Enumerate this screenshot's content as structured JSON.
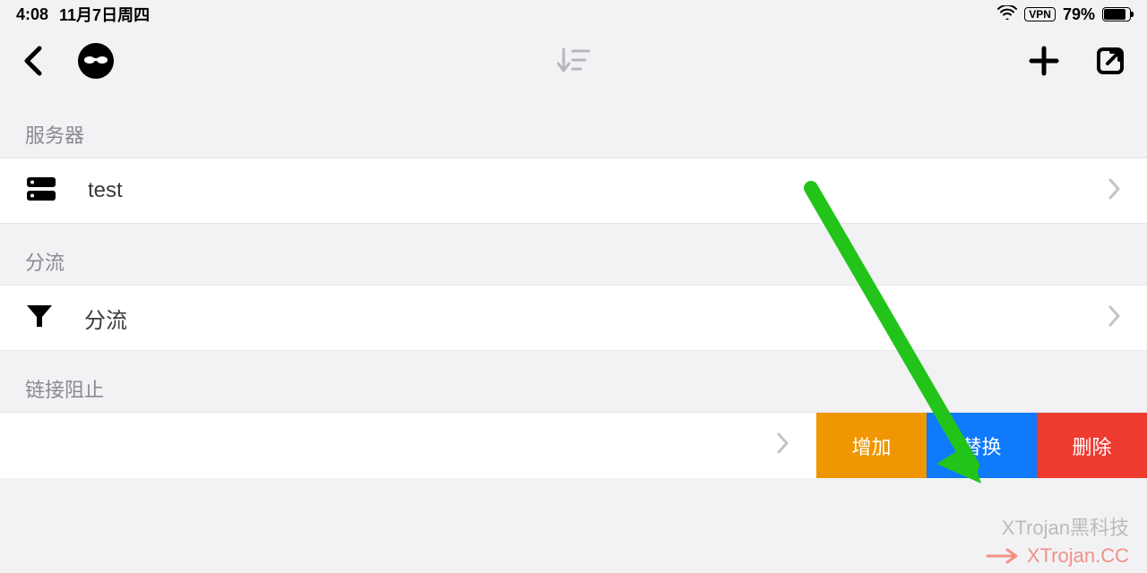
{
  "status": {
    "time": "4:08",
    "date": "11月7日周四",
    "vpn_label": "VPN",
    "battery_pct": "79%"
  },
  "sections": {
    "server": {
      "header": "服务器",
      "item_label": "test"
    },
    "routing": {
      "header": "分流",
      "item_label": "分流"
    },
    "block": {
      "header": "链接阻止"
    }
  },
  "actions": {
    "add": "增加",
    "replace": "替换",
    "delete": "删除"
  },
  "watermark": {
    "line1": "XTrojan黑科技",
    "line2": "XTrojan.CC"
  },
  "colors": {
    "action_add": "#ef9600",
    "action_replace": "#0f7afc",
    "action_delete": "#ee3b2f",
    "arrow": "#22c41a"
  }
}
